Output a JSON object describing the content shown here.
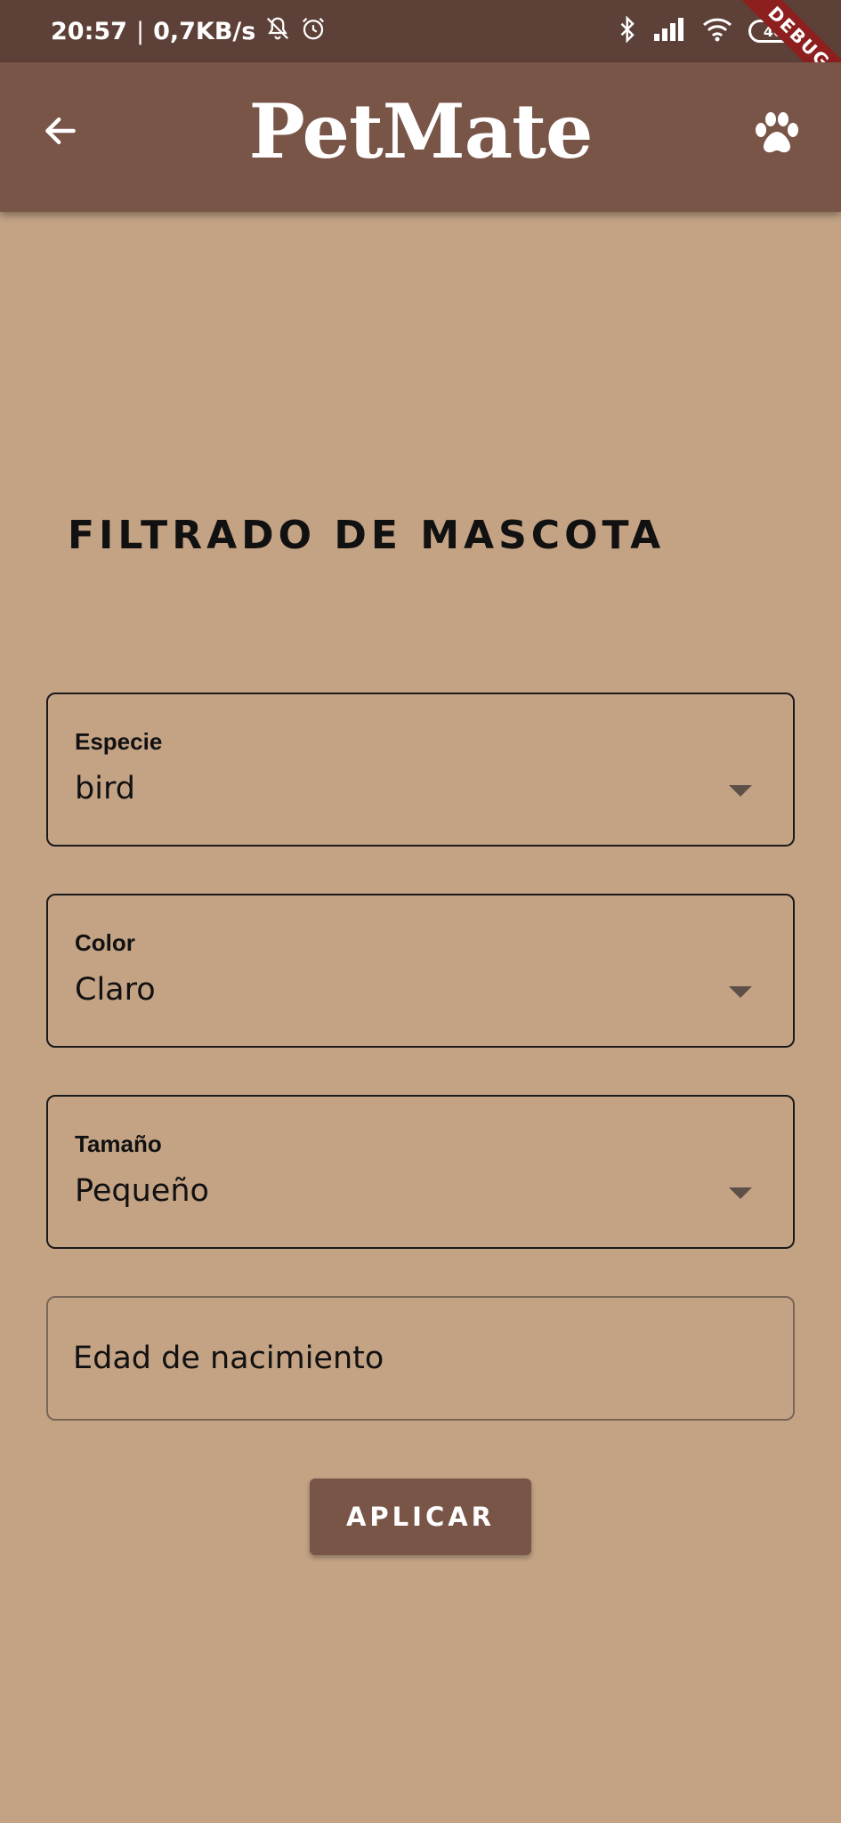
{
  "status_bar": {
    "time": "20:57",
    "separator": "|",
    "net_speed": "0,7KB/s",
    "battery": "40",
    "debug_label": "DEBUG"
  },
  "app_bar": {
    "title": "PetMate"
  },
  "page": {
    "title": "FILTRADO DE MASCOTA"
  },
  "filters": {
    "species": {
      "label": "Especie",
      "value": "bird"
    },
    "color": {
      "label": "Color",
      "value": "Claro"
    },
    "size": {
      "label": "Tamaño",
      "value": "Pequeño"
    },
    "birth_age": {
      "placeholder": "Edad de nacimiento"
    }
  },
  "actions": {
    "apply_label": "APLICAR"
  },
  "colors": {
    "status_bar": "#5d4037",
    "app_bar": "#795548",
    "background": "#c4a385",
    "button": "#795548"
  }
}
